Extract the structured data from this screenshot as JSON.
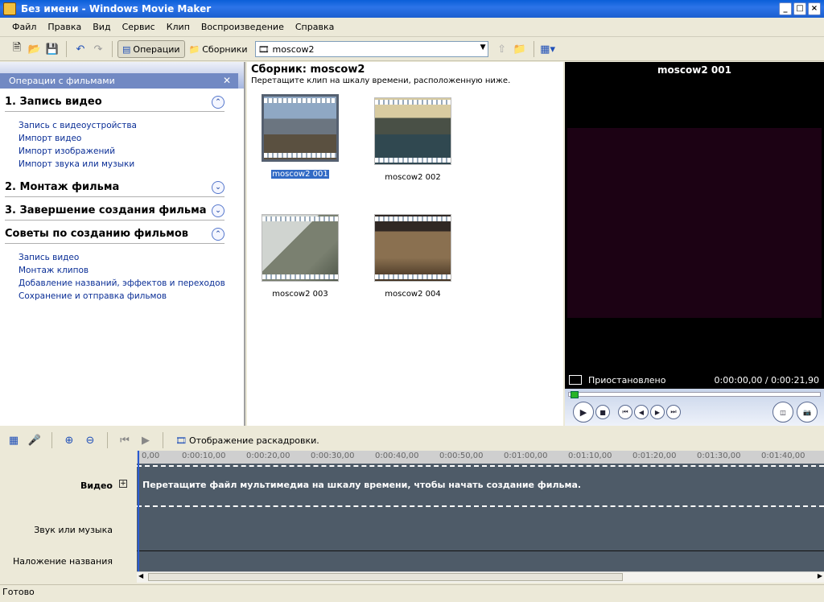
{
  "window": {
    "title": "Без имени - Windows Movie Maker",
    "controls": [
      "_",
      "□",
      "×"
    ]
  },
  "menu": [
    "Файл",
    "Правка",
    "Вид",
    "Сервис",
    "Клип",
    "Воспроизведение",
    "Справка"
  ],
  "toolbar": {
    "operations_label": "Операции",
    "collections_label": "Сборники",
    "collection_value": "moscow2"
  },
  "left": {
    "header": "Операции с фильмами",
    "sections": [
      {
        "title": "1. Запись видео",
        "links": [
          "Запись с видеоустройства",
          "Импорт видео",
          "Импорт изображений",
          "Импорт звука или музыки"
        ]
      },
      {
        "title": "2. Монтаж фильма",
        "links": []
      },
      {
        "title": "3. Завершение создания фильма",
        "links": []
      },
      {
        "title": "Советы по созданию фильмов",
        "links": [
          "Запись видео",
          "Монтаж клипов",
          "Добавление названий, эффектов и переходов",
          "Сохранение и отправка фильмов"
        ]
      }
    ]
  },
  "collection": {
    "title": "Сборник: moscow2",
    "subtitle": "Перетащите клип на шкалу времени, расположенную ниже.",
    "clips": [
      {
        "label": "moscow2 001",
        "selected": true
      },
      {
        "label": "moscow2 002",
        "selected": false
      },
      {
        "label": "moscow2 003",
        "selected": false
      },
      {
        "label": "moscow2 004",
        "selected": false
      }
    ]
  },
  "preview": {
    "title": "moscow2 001",
    "status": "Приостановлено",
    "time": "0:00:00,00 / 0:00:21,90",
    "progress": 0
  },
  "timeline": {
    "storyboard_label": "Отображение раскадровки.",
    "ticks": [
      "0,00",
      "0:00:10,00",
      "0:00:20,00",
      "0:00:30,00",
      "0:00:40,00",
      "0:00:50,00",
      "0:01:00,00",
      "0:01:10,00",
      "0:01:20,00",
      "0:01:30,00",
      "0:01:40,00"
    ],
    "tracks": {
      "video": "Видео",
      "audio": "Звук или музыка",
      "title_overlay": "Наложение названия"
    },
    "hint": "Перетащите файл мультимедиа на шкалу времени, чтобы начать создание фильма."
  },
  "status": "Готово"
}
